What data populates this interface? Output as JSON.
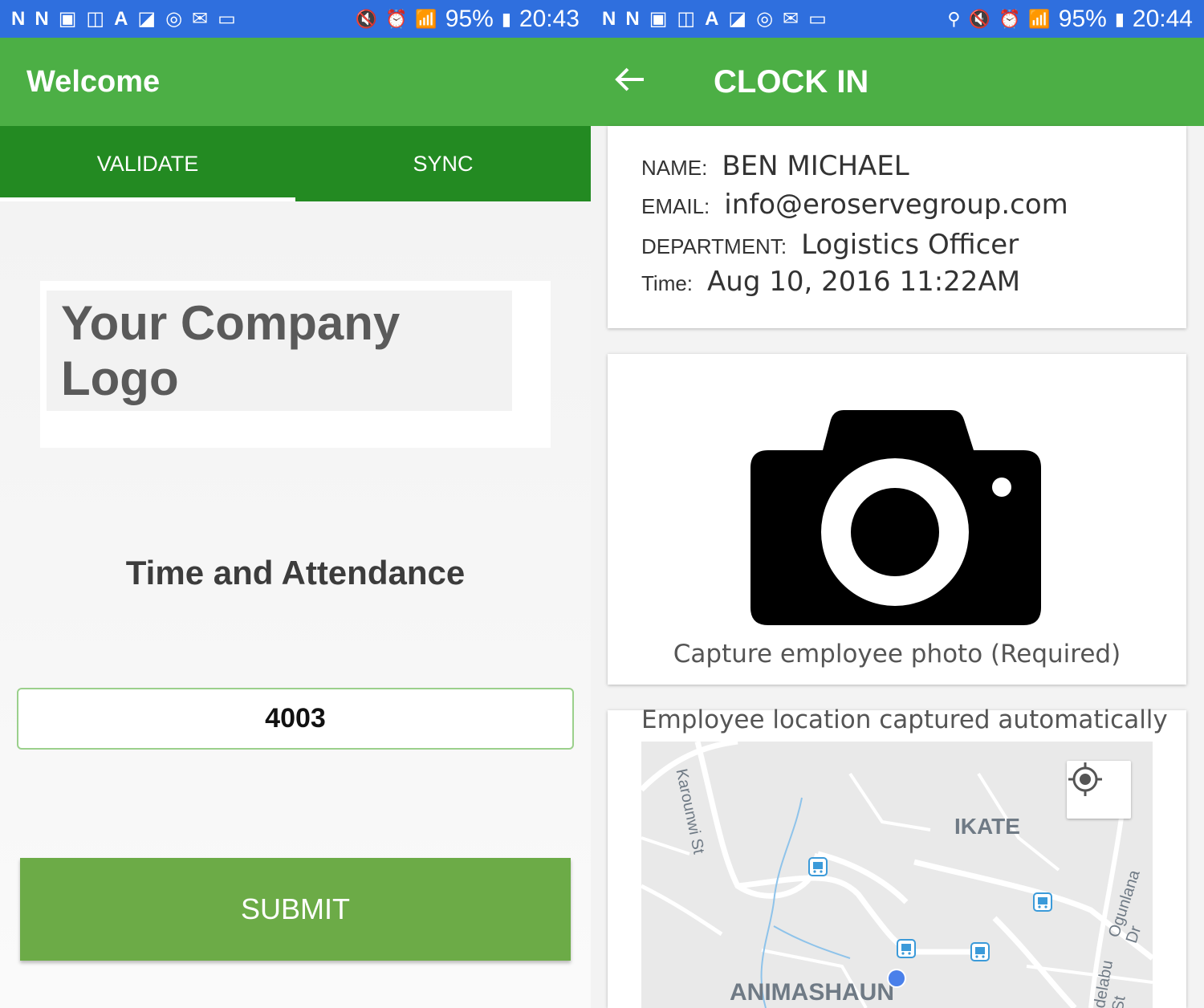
{
  "left": {
    "status": {
      "time": "20:43",
      "battery": "95%"
    },
    "appbar": {
      "title": "Welcome"
    },
    "tabs": [
      {
        "label": "VALIDATE",
        "active": true
      },
      {
        "label": "SYNC",
        "active": false
      }
    ],
    "logo_text": "Your Company Logo",
    "subtitle": "Time and Attendance",
    "employee_id_value": "4003",
    "submit_label": "SUBMIT"
  },
  "right": {
    "status": {
      "time": "20:44",
      "battery": "95%"
    },
    "appbar": {
      "title": "CLOCK IN"
    },
    "employee": {
      "name_label": "NAME:",
      "name": "BEN MICHAEL",
      "email_label": "EMAIL:",
      "email": "info@eroservegroup.com",
      "department_label": "DEPARTMENT:",
      "department": "Logistics Officer",
      "time_label": "Time:",
      "time": "Aug 10, 2016 11:22AM"
    },
    "photo_caption": "Capture employee photo (Required)",
    "location_caption": "Employee location captured automatically",
    "map_labels": {
      "area_1": "IKATE",
      "area_2": "ANIMASHAUN",
      "street_1": "Karounwi St",
      "street_2": "Ogunlana Dr",
      "street_3": "delabu St"
    }
  },
  "colors": {
    "status_bar": "#2f6fde",
    "app_bar": "#4caf45",
    "tab_bar": "#238a22",
    "submit": "#6cab47"
  },
  "icons": [
    "back-arrow-icon",
    "camera-icon",
    "my-location-icon",
    "bus-stop-icon",
    "location-dot-icon"
  ]
}
